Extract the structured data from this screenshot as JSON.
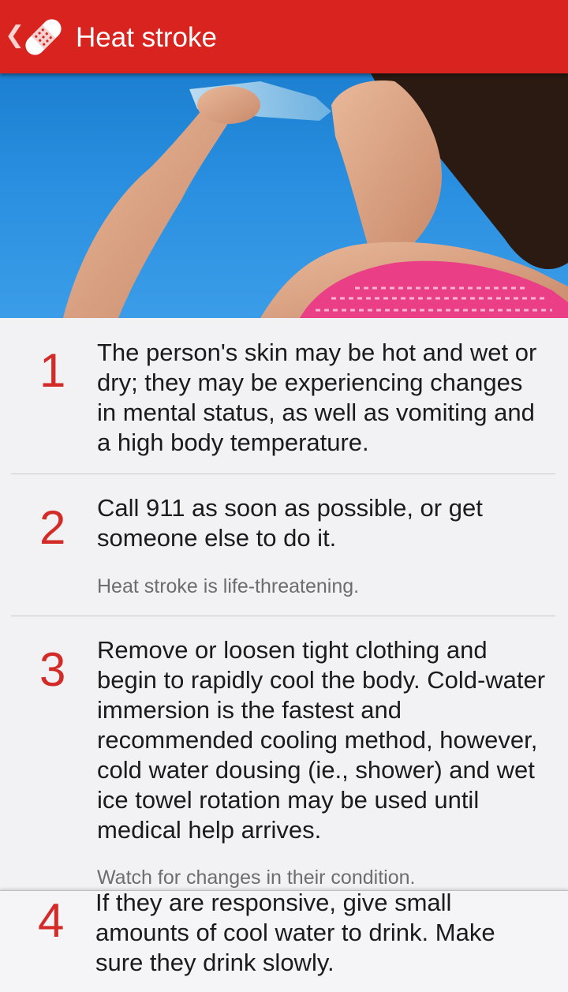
{
  "app_bar": {
    "title": "Heat stroke",
    "back_icon": "chevron-left-icon",
    "app_icon": "bandage-icon",
    "color": "#d9231f"
  },
  "hero_image": {
    "subject": "woman drinking from water bottle"
  },
  "accent_color": "#d32b27",
  "steps": [
    {
      "number": "1",
      "text": "The person's skin may be hot and wet or dry; they may be experiencing changes in mental status, as well as vomiting and a high body temperature.",
      "note": ""
    },
    {
      "number": "2",
      "text": "Call 911 as soon as possible, or get someone else to do it.",
      "note": "Heat stroke is life-threatening."
    },
    {
      "number": "3",
      "text": "Remove or loosen tight clothing and begin to rapidly cool the body. Cold-water immersion is the fastest and recommended cooling method, however, cold water dousing (ie., shower) and wet ice towel rotation may be used until medical help arrives.",
      "note": "Watch for changes in their condition."
    },
    {
      "number": "4",
      "text": "If they are responsive, give small amounts of cool water to drink. Make sure they drink slowly.",
      "note": ""
    }
  ]
}
